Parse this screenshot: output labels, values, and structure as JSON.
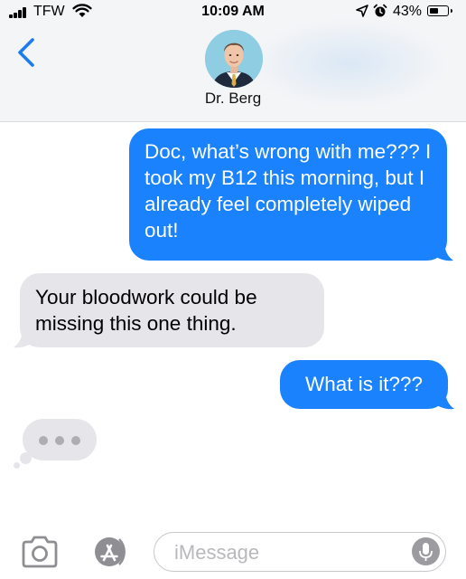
{
  "status_bar": {
    "carrier": "TFW",
    "time": "10:09 AM",
    "battery": "43%"
  },
  "header": {
    "contact_name": "Dr. Berg",
    "icons": [
      "back-chevron-icon",
      "avatar"
    ]
  },
  "messages": [
    {
      "direction": "sent",
      "text": "Doc, what’s wrong with me??? I took my B12 this morning, but I already feel completely wiped out!"
    },
    {
      "direction": "received",
      "text": "Your bloodwork could be missing this one thing."
    },
    {
      "direction": "sent",
      "text": "What is it???"
    }
  ],
  "typing_indicator": {
    "visible": true
  },
  "input_bar": {
    "placeholder": "iMessage",
    "icons": [
      "camera-icon",
      "app-store-icon",
      "microphone-icon"
    ]
  },
  "colors": {
    "sent_bubble": "#1982fc",
    "received_bubble": "#e5e5ea",
    "accent": "#1a7cf0"
  }
}
